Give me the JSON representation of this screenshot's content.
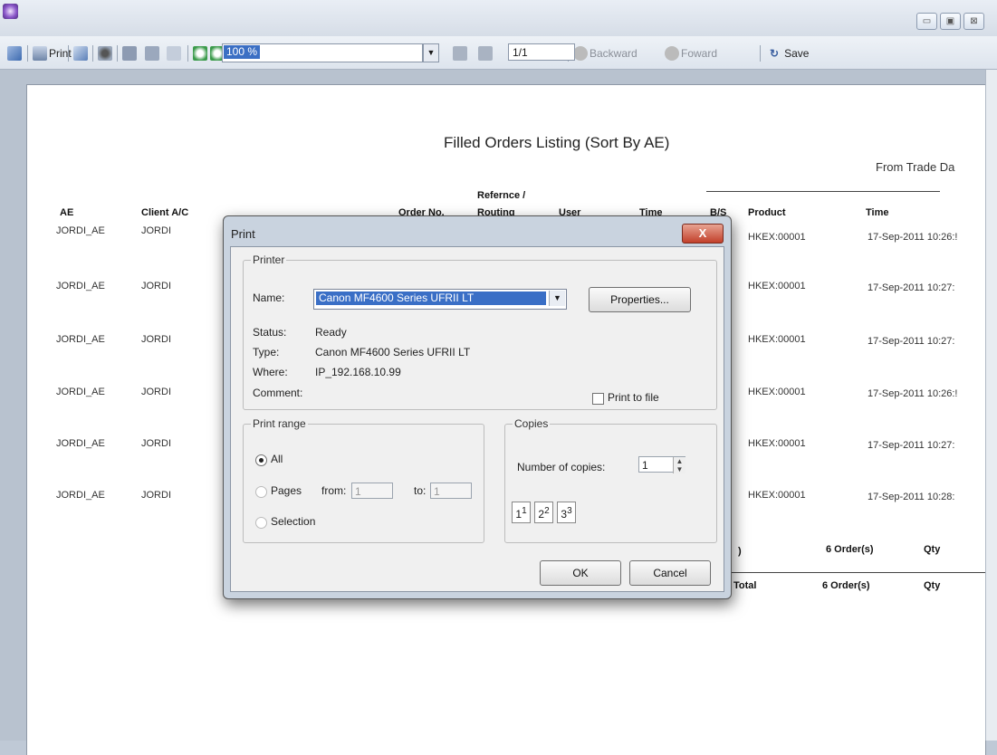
{
  "window": {
    "controls": [
      "▭",
      "▣",
      "⊠"
    ]
  },
  "toolbar": {
    "print_label": "Print",
    "zoom_value": "100 %",
    "page_value": "1/1",
    "backward_label": "Backward",
    "forward_label": "Foward",
    "save_label": "Save"
  },
  "report": {
    "title": "Filled Orders Listing (Sort By AE)",
    "subtitle": "From Trade Da",
    "headers": {
      "ae": "AE",
      "client": "Client A/C",
      "order_no": "Order No.",
      "reference_line1": "Refernce /",
      "reference_line2": "Routing",
      "user": "User",
      "time1": "Time",
      "bs": "B/S",
      "product": "Product",
      "time2": "Time"
    },
    "rows": [
      {
        "ae": "JORDI_AE",
        "client": "JORDI",
        "product": "HKEX:00001",
        "time": "17-Sep-2011 10:26:!"
      },
      {
        "ae": "JORDI_AE",
        "client": "JORDI",
        "product": "HKEX:00001",
        "time": "17-Sep-2011 10:27:"
      },
      {
        "ae": "JORDI_AE",
        "client": "JORDI",
        "product": "HKEX:00001",
        "time": "17-Sep-2011 10:27:"
      },
      {
        "ae": "JORDI_AE",
        "client": "JORDI",
        "product": "HKEX:00001",
        "time": "17-Sep-2011 10:26:!"
      },
      {
        "ae": "JORDI_AE",
        "client": "JORDI",
        "product": "HKEX:00001",
        "time": "17-Sep-2011 10:27:"
      },
      {
        "ae": "JORDI_AE",
        "client": "JORDI",
        "product": "HKEX:00001",
        "time": "17-Sep-2011 10:28:"
      }
    ],
    "summary1": {
      "paren": ")",
      "orders": "6 Order(s)",
      "qty": "Qty"
    },
    "summary2": {
      "label": "Total",
      "orders": "6 Order(s)",
      "qty": "Qty"
    }
  },
  "dialog": {
    "title": "Print",
    "close": "X",
    "printer_group": "Printer",
    "name_label": "Name:",
    "name_value": "Canon MF4600 Series UFRII LT",
    "properties_button": "Properties...",
    "status_label": "Status:",
    "status_value": "Ready",
    "type_label": "Type:",
    "type_value": "Canon MF4600 Series UFRII LT",
    "where_label": "Where:",
    "where_value": "IP_192.168.10.99",
    "comment_label": "Comment:",
    "print_to_file": "Print to file",
    "range_group": "Print range",
    "all_label": "All",
    "pages_label": "Pages",
    "from_label": "from:",
    "from_value": "1",
    "to_label": "to:",
    "to_value": "1",
    "selection_label": "Selection",
    "copies_group": "Copies",
    "copies_label": "Number of copies:",
    "copies_value": "1",
    "collate_pages": [
      "1",
      "1",
      "2",
      "2",
      "3",
      "3"
    ],
    "ok_button": "OK",
    "cancel_button": "Cancel"
  }
}
